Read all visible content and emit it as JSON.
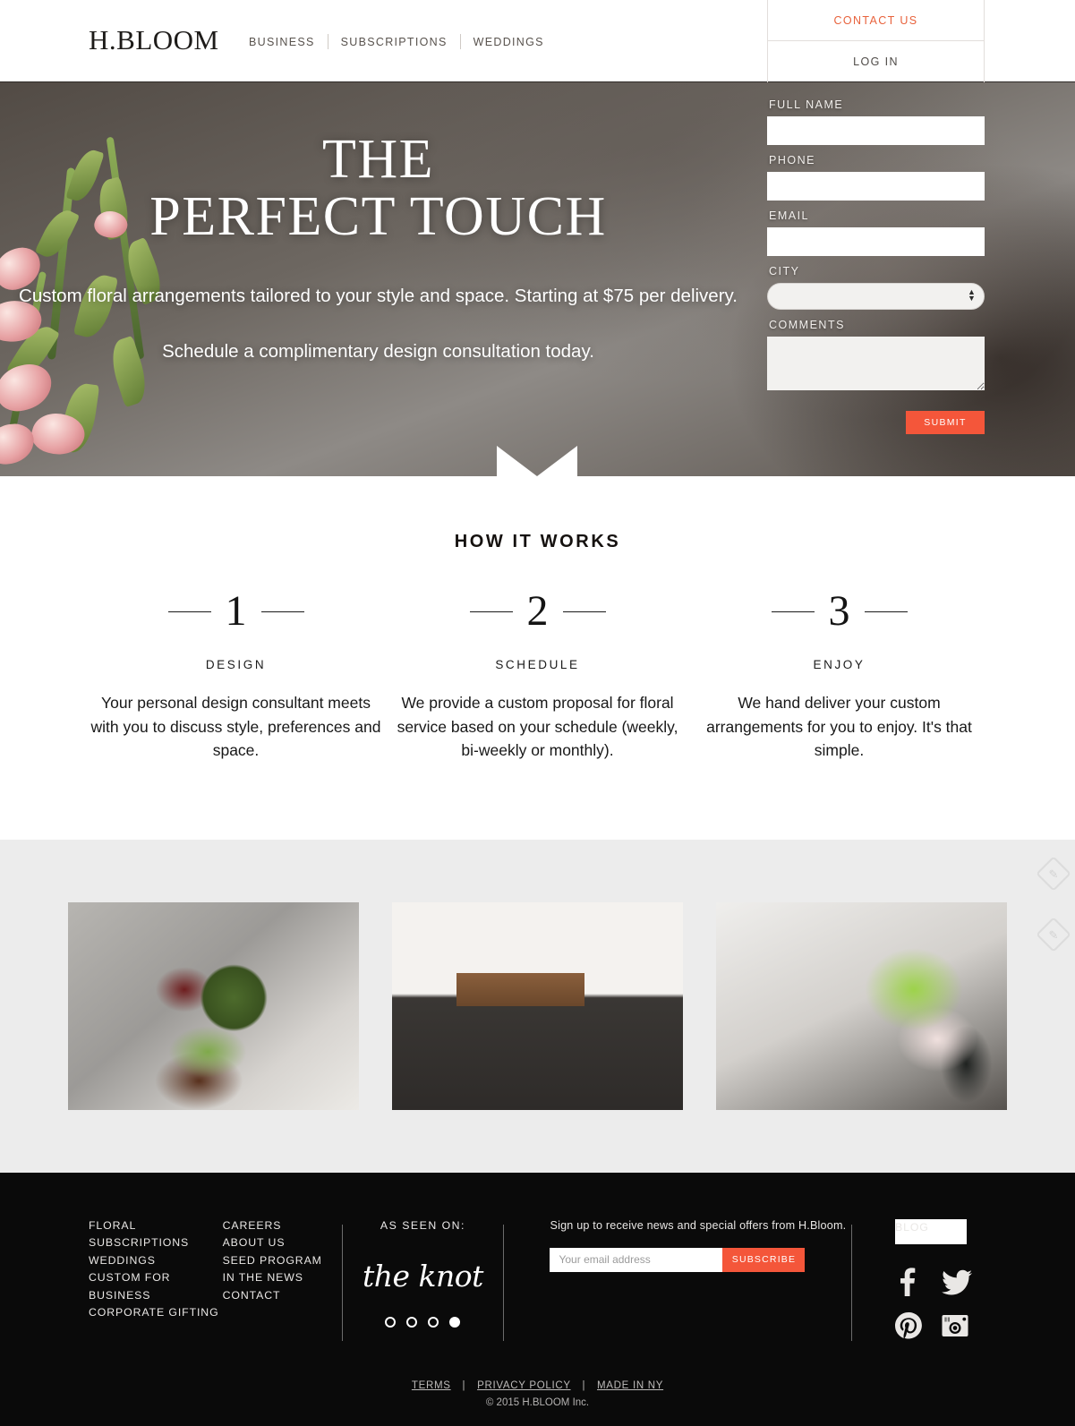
{
  "header": {
    "logo": "H.BLOOM",
    "nav": [
      {
        "label": "BUSINESS"
      },
      {
        "label": "SUBSCRIPTIONS"
      },
      {
        "label": "WEDDINGS"
      }
    ],
    "contact_label": "CONTACT US",
    "login_label": "LOG IN",
    "accent_color": "#e8623c"
  },
  "hero": {
    "title_line1": "THE",
    "title_line2": "PERFECT TOUCH",
    "subtitle": "Custom floral arrangements tailored to your style and space. Starting at $75 per delivery.",
    "cta_text": "Schedule a complimentary design consultation today."
  },
  "form": {
    "fields": [
      {
        "label": "FULL NAME",
        "type": "text",
        "value": "",
        "placeholder": ""
      },
      {
        "label": "PHONE",
        "type": "text",
        "value": "",
        "placeholder": ""
      },
      {
        "label": "EMAIL",
        "type": "text",
        "value": "",
        "placeholder": ""
      },
      {
        "label": "CITY",
        "type": "select",
        "value": "",
        "placeholder": ""
      },
      {
        "label": "COMMENTS",
        "type": "textarea",
        "value": "",
        "placeholder": ""
      }
    ],
    "submit_label": "SUBMIT",
    "submit_color": "#f4563a"
  },
  "how_it_works": {
    "title": "HOW IT WORKS",
    "steps": [
      {
        "number": "1",
        "name": "DESIGN",
        "copy": "Your personal design consultant meets with you to discuss style, preferences and space."
      },
      {
        "number": "2",
        "name": "SCHEDULE",
        "copy": "We provide a custom proposal for floral service based on your schedule (weekly, bi-weekly or monthly)."
      },
      {
        "number": "3",
        "name": "ENJOY",
        "copy": "We hand deliver your custom arrangements for you to enjoy. It's that simple."
      }
    ]
  },
  "gallery": {
    "background_color": "#ececec",
    "items": [
      {
        "alt": "succulent terrarium in glass vessel"
      },
      {
        "alt": "modern living room with coffee table arrangement"
      },
      {
        "alt": "fern and orchid arrangement in office lounge"
      }
    ]
  },
  "side_widgets": [
    {
      "icon": "feedback-diamond-icon",
      "glyph": "✎"
    },
    {
      "icon": "feedback-diamond-icon",
      "glyph": "✎"
    }
  ],
  "footer": {
    "links_col1": [
      {
        "label": "FLORAL SUBSCRIPTIONS"
      },
      {
        "label": "WEDDINGS"
      },
      {
        "label": "CUSTOM FOR BUSINESS"
      },
      {
        "label": "CORPORATE GIFTING"
      }
    ],
    "links_col2": [
      {
        "label": "CAREERS"
      },
      {
        "label": "ABOUT US"
      },
      {
        "label": "SEED PROGRAM"
      },
      {
        "label": "IN THE NEWS"
      },
      {
        "label": "CONTACT"
      }
    ],
    "as_seen_on": {
      "label": "AS SEEN ON:",
      "logo_text": "the knot",
      "dots_total": 4,
      "active_dot": 4
    },
    "newsletter": {
      "copy": "Sign up to receive news and special offers from H.Bloom.",
      "placeholder": "Your email address",
      "value": "",
      "button_label": "SUBSCRIBE",
      "button_color": "#f4563a"
    },
    "blog_label": "BLOG",
    "social": [
      {
        "name": "facebook-icon"
      },
      {
        "name": "twitter-icon"
      },
      {
        "name": "pinterest-icon"
      },
      {
        "name": "instagram-icon"
      }
    ],
    "legal": [
      {
        "label": "TERMS"
      },
      {
        "label": "PRIVACY POLICY"
      },
      {
        "label": "MADE IN NY"
      }
    ],
    "legal_separator": "|",
    "copyright": "© 2015 H.BLOOM Inc."
  }
}
